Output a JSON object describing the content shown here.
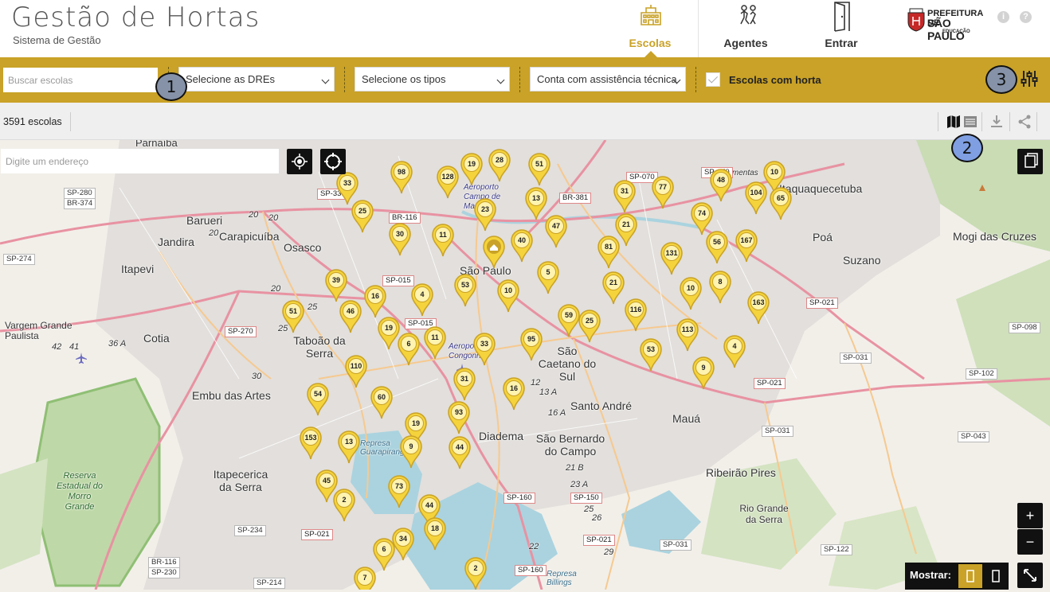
{
  "header": {
    "title": "Gestão de Hortas",
    "subtitle": "Sistema de Gestão",
    "tabs": [
      {
        "label": "Escolas",
        "icon": "school-icon",
        "active": true
      },
      {
        "label": "Agentes",
        "icon": "agents-icon",
        "active": false
      },
      {
        "label": "Entrar",
        "icon": "door-icon",
        "active": false
      }
    ],
    "logo": {
      "line1": "PREFEITURA DE",
      "line2": "SÃO PAULO",
      "line3": "EDUCAÇÃO"
    },
    "info_icon": "i",
    "help_icon": "?"
  },
  "filters": {
    "search_placeholder": "Buscar escolas",
    "dre_select": "Selecione as DREs",
    "tipos_select": "Selecione os tipos",
    "assistencia_select": "Conta com assistência técnica",
    "horta_label": "Escolas com horta",
    "horta_checked": true
  },
  "toolbar": {
    "count": "3591 escolas"
  },
  "map": {
    "address_placeholder": "Digite um endereço",
    "zoom_in": "+",
    "zoom_out": "−",
    "mostrar_label": "Mostrar:",
    "place_labels": [
      "Parnaíba",
      "Barueri",
      "Carapicuíba",
      "Jandira",
      "Osasco",
      "Itapevi",
      "São Paulo",
      "Vargem Grande Paulista",
      "Cotia",
      "Taboão da Serra",
      "Embu das Artes",
      "São Caetano do Sul",
      "Santo André",
      "Mauá",
      "Diadema",
      "São Bernardo do Campo",
      "Itapecerica da Serra",
      "Reserva Estadual do Morro Grande",
      "Ribeirão Pires",
      "Rio Grande da Serra",
      "Suzano",
      "Poá",
      "Mogi das Cruzes",
      "Itaquaquecetuba",
      "Pimentas",
      "Represa Guarapiranga",
      "Represa Billings",
      "Aeroporto Campo de Marte",
      "Aeroporto de Congonhas"
    ],
    "road_labels": [
      "SP-280",
      "BR-374",
      "SP-330",
      "BR-116",
      "SP-070",
      "SP-070",
      "BR-381",
      "SP-274",
      "SP-015",
      "SP-015",
      "SP-270",
      "SP-021",
      "SP-098",
      "SP-031",
      "SP-102",
      "SP-021",
      "SP-031",
      "SP-043",
      "SP-234",
      "SP-021",
      "SP-160",
      "SP-150",
      "SP-021",
      "SP-031",
      "SP-122",
      "BR-116",
      "SP-230",
      "SP-214",
      "SP-160"
    ],
    "km_labels": [
      "20",
      "20",
      "20",
      "25",
      "20",
      "42",
      "41",
      "36 A",
      "25",
      "30",
      "12",
      "13 A",
      "16 A",
      "21 B",
      "23 A",
      "25",
      "26",
      "29",
      "22"
    ],
    "markers": [
      "33",
      "98",
      "128",
      "19",
      "28",
      "51",
      "25",
      "23",
      "13",
      "31",
      "77",
      "48",
      "10",
      "104",
      "65",
      "30",
      "11",
      "47",
      "21",
      "74",
      "40",
      "81",
      "131",
      "56",
      "167",
      "5",
      "10",
      "39",
      "16",
      "4",
      "53",
      "51",
      "46",
      "21",
      "8",
      "163",
      "116",
      "10",
      "59",
      "25",
      "19",
      "6",
      "11",
      "33",
      "95",
      "113",
      "4",
      "53",
      "110",
      "31",
      "9",
      "16",
      "54",
      "60",
      "19",
      "93",
      "153",
      "13",
      "9",
      "44",
      "45",
      "73",
      "2",
      "44",
      "18",
      "34",
      "6",
      "7",
      "2"
    ]
  },
  "badges": [
    "1",
    "2",
    "3"
  ]
}
